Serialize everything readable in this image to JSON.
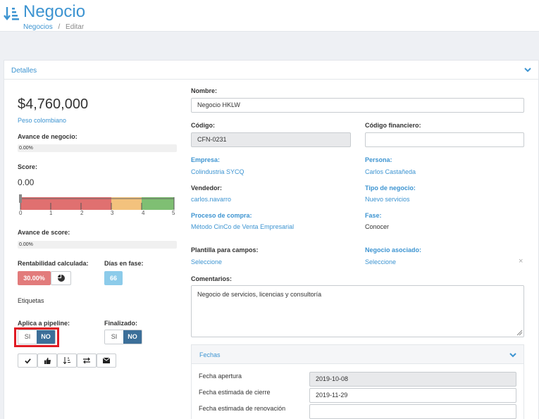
{
  "header": {
    "title": "Negocio",
    "breadcrumb": {
      "parent": "Negocios",
      "separator": "/",
      "current": "Editar"
    }
  },
  "details": {
    "section_title": "Detalles"
  },
  "left": {
    "amount": "$4,760,000",
    "currency": "Peso colombiano",
    "avance_negocio_label": "Avance de negocio:",
    "avance_negocio_value": "0.00%",
    "avance_negocio_fraction": 0.0,
    "score_label": "Score:",
    "score_value": "0.00",
    "score_ticks": [
      "0",
      "1",
      "2",
      "3",
      "4",
      "5"
    ],
    "score_scale": {
      "min": 0,
      "max": 5,
      "value": 0.0,
      "segments": [
        {
          "from": 0,
          "to": 3,
          "color": "#e07070"
        },
        {
          "from": 3,
          "to": 4,
          "color": "#f3c27d"
        },
        {
          "from": 4,
          "to": 5,
          "color": "#7fbf73"
        }
      ]
    },
    "avance_score_label": "Avance de score:",
    "avance_score_value": "0.00%",
    "rentabilidad_label": "Rentabilidad calculada:",
    "rentabilidad_value": "30.00%",
    "dias_label": "Días en fase:",
    "dias_value": "66",
    "etiquetas_label": "Etiquetas",
    "pipeline_label": "Aplica a pipeline:",
    "finalizado_label": "Finalizado:",
    "toggle_si": "SI",
    "toggle_no": "NO"
  },
  "form": {
    "nombre_label": "Nombre:",
    "nombre_value": "Negocio HKLW",
    "codigo_label": "Código:",
    "codigo_value": "CFN-0231",
    "codigo_fin_label": "Código financiero:",
    "codigo_fin_value": "",
    "empresa_label": "Empresa:",
    "empresa_value": "Colindustria SYCQ",
    "persona_label": "Persona:",
    "persona_value": "Carlos Castañeda",
    "vendedor_label": "Vendedor:",
    "vendedor_value": "carlos.navarro",
    "tipo_label": "Tipo de negocio:",
    "tipo_value": "Nuevo servicios",
    "proceso_label": "Proceso de compra:",
    "proceso_value": "Método CinCo de Venta Empresarial",
    "fase_label": "Fase:",
    "fase_value": "Conocer",
    "plantilla_label": "Plantilla para campos:",
    "plantilla_value": "Seleccione",
    "asociado_label": "Negocio asociado:",
    "asociado_value": "Seleccione",
    "asociado_clear": "×",
    "comentarios_label": "Comentarios:",
    "comentarios_value": "Negocio de servicios, licencias y consultoría"
  },
  "fechas": {
    "title": "Fechas",
    "apertura_label": "Fecha apertura",
    "apertura_value": "2019-10-08",
    "cierre_label": "Fecha estimada de cierre",
    "cierre_value": "2019-11-29",
    "renovacion_label": "Fecha estimada de renovación",
    "renovacion_value": ""
  },
  "colors": {
    "accent": "#3d94d1",
    "toggle_active": "#3c6f99",
    "rentabilidad_badge": "#e27b7b",
    "dias_badge": "#8ccbea",
    "highlight": "#e01b24"
  },
  "icons": [
    "sort-icon",
    "chevron-down-icon",
    "pie-chart-icon",
    "check-icon",
    "thumbs-up-icon",
    "sort-numeric-icon",
    "exchange-icon",
    "envelope-icon"
  ]
}
